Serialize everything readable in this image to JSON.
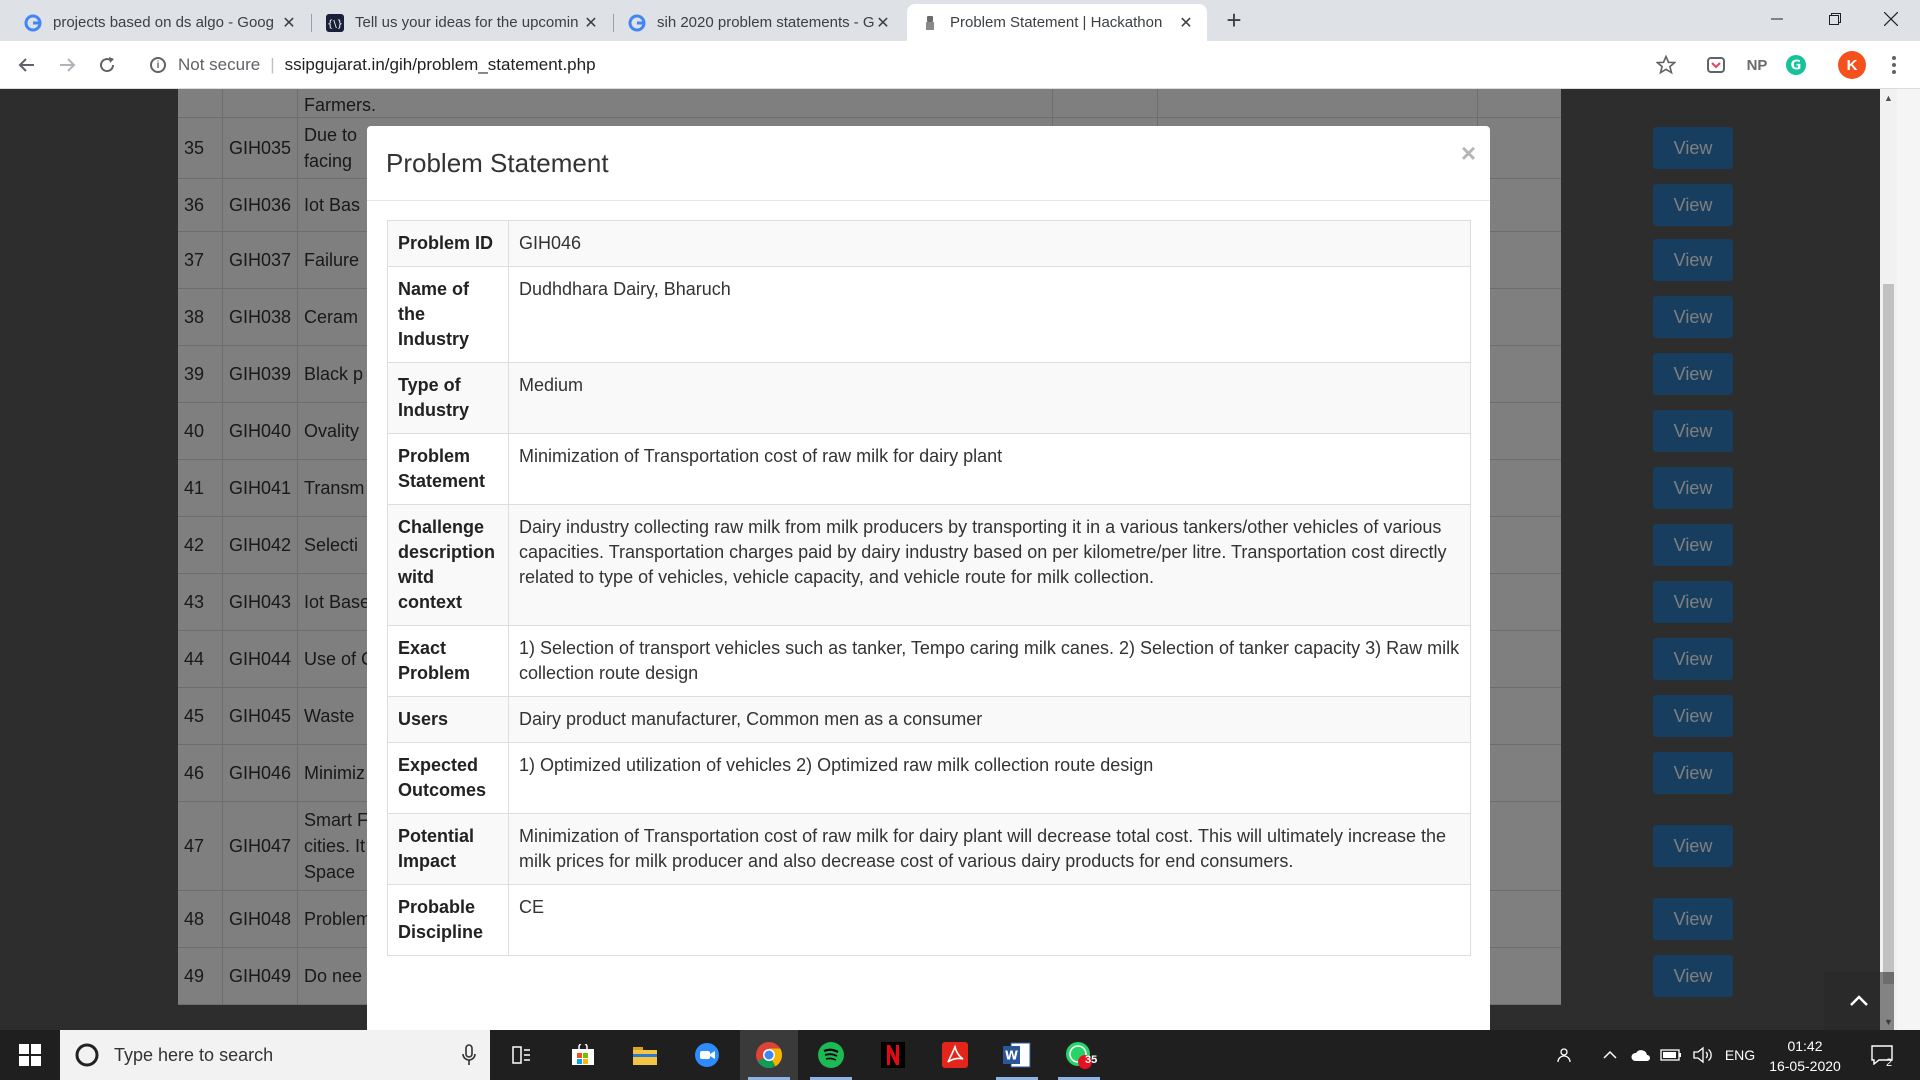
{
  "browser": {
    "tabs": [
      {
        "title": "projects based on ds algo - Goog",
        "favicon": "google-icon",
        "active": false
      },
      {
        "title": "Tell us your ideas for the upcomin",
        "favicon": "site-icon",
        "active": false
      },
      {
        "title": "sih 2020 problem statements - G",
        "favicon": "google-icon",
        "active": false
      },
      {
        "title": "Problem Statement | Hackathon",
        "favicon": "emblem-icon",
        "active": true
      }
    ],
    "security_label": "Not secure",
    "url": "ssipgujarat.in/gih/problem_statement.php",
    "extensions": {
      "np_label": "NP",
      "profile_initial": "K"
    }
  },
  "colors": {
    "view_button": "#2e7bbf",
    "taskbar": "#1f1f20",
    "profile": "#f4511e",
    "grammarly": "#15c39a"
  },
  "background_table": {
    "top_text": "Farmers.",
    "view_label": "View",
    "rows": [
      {
        "no": "35",
        "id": "GIH035",
        "title_lines": [
          "Due to",
          "facing"
        ]
      },
      {
        "no": "36",
        "id": "GIH036",
        "title_lines": [
          "Iot Bas"
        ]
      },
      {
        "no": "37",
        "id": "GIH037",
        "title_lines": [
          "Failure"
        ]
      },
      {
        "no": "38",
        "id": "GIH038",
        "title_lines": [
          "Ceram"
        ]
      },
      {
        "no": "39",
        "id": "GIH039",
        "title_lines": [
          "Black p"
        ]
      },
      {
        "no": "40",
        "id": "GIH040",
        "title_lines": [
          "Ovality"
        ]
      },
      {
        "no": "41",
        "id": "GIH041",
        "title_lines": [
          "Transm"
        ]
      },
      {
        "no": "42",
        "id": "GIH042",
        "title_lines": [
          "Selecti"
        ]
      },
      {
        "no": "43",
        "id": "GIH043",
        "title_lines": [
          "Iot Base"
        ]
      },
      {
        "no": "44",
        "id": "GIH044",
        "title_lines": [
          "Use of C"
        ]
      },
      {
        "no": "45",
        "id": "GIH045",
        "title_lines": [
          "Waste"
        ]
      },
      {
        "no": "46",
        "id": "GIH046",
        "title_lines": [
          "Minimiz"
        ]
      },
      {
        "no": "47",
        "id": "GIH047",
        "title_lines": [
          "Smart F",
          "cities. It",
          "Space"
        ]
      },
      {
        "no": "48",
        "id": "GIH048",
        "title_lines": [
          "Problem"
        ]
      },
      {
        "no": "49",
        "id": "GIH049",
        "title_lines": [
          "Do nee"
        ]
      }
    ]
  },
  "modal": {
    "title": "Problem Statement",
    "close_glyph": "×",
    "rows": [
      {
        "key": "Problem ID",
        "value": "GIH046"
      },
      {
        "key": "Name of the Industry",
        "value": "Dudhdhara Dairy, Bharuch"
      },
      {
        "key": "Type of Industry",
        "value": "Medium"
      },
      {
        "key": "Problem Statement",
        "value": "Minimization of Transportation cost of raw milk for dairy plant"
      },
      {
        "key": "Challenge description witd context",
        "value": "Dairy industry collecting raw milk from milk producers by transporting it in a various tankers/other vehicles of various capacities. Transportation charges paid by dairy industry based on per kilometre/per litre. Transportation cost directly related to type of vehicles, vehicle capacity, and vehicle route for milk collection."
      },
      {
        "key": "Exact Problem",
        "value": "1) Selection of transport vehicles such as tanker, Tempo caring milk canes. 2) Selection of tanker capacity 3) Raw milk collection route design"
      },
      {
        "key": "Users",
        "value": "Dairy product manufacturer, Common men as a consumer"
      },
      {
        "key": "Expected Outcomes",
        "value": "1) Optimized utilization of vehicles 2) Optimized raw milk collection route design"
      },
      {
        "key": "Potential Impact",
        "value": "Minimization of Transportation cost of raw milk for dairy plant will decrease total cost. This will ultimately increase the milk prices for milk producer and also decrease cost of various dairy products for end consumers."
      },
      {
        "key": "Probable Discipline",
        "value": "CE"
      }
    ]
  },
  "taskbar": {
    "search_placeholder": "Type here to search",
    "whatsapp_badge": "35",
    "language": "ENG",
    "time": "01:42",
    "date": "16-05-2020",
    "notification_count": "2"
  }
}
